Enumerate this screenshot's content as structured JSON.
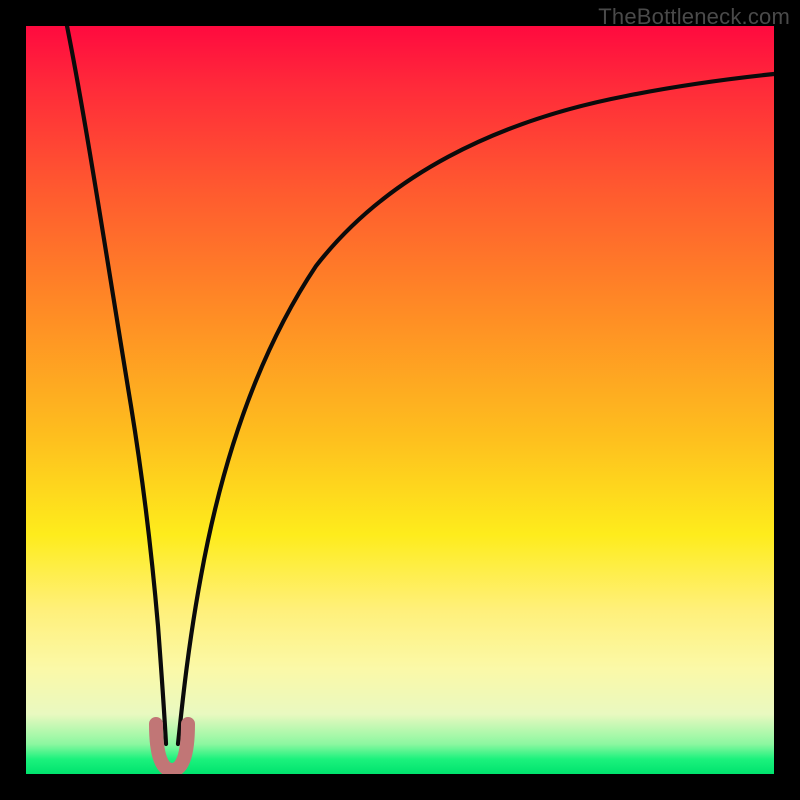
{
  "watermark": "TheBottleneck.com",
  "colors": {
    "frame": "#000000",
    "gradient_top": "#ff0a3f",
    "gradient_bottom": "#00e36e",
    "curve_stroke": "#0b0b0b",
    "dip_fill": "#c17676"
  },
  "chart_data": {
    "type": "line",
    "title": "",
    "xlabel": "",
    "ylabel": "",
    "xlim": [
      0,
      100
    ],
    "ylim": [
      0,
      100
    ],
    "note": "V-shaped curve with minimum near x≈18; left branch reaches top at x≈5.5, right branch is a sublinear rise reaching top-right near x≈100, y≈86.",
    "series": [
      {
        "name": "left-branch",
        "x": [
          5.5,
          7,
          9,
          11,
          13,
          14.5,
          16,
          17,
          17.8
        ],
        "y": [
          100,
          86,
          68,
          50,
          34,
          22,
          12,
          6,
          2
        ]
      },
      {
        "name": "right-branch",
        "x": [
          19.0,
          20,
          22,
          25,
          29,
          34,
          40,
          48,
          58,
          70,
          84,
          100
        ],
        "y": [
          2,
          6,
          14,
          24,
          36,
          47,
          56,
          64,
          71,
          77,
          82,
          86
        ]
      }
    ],
    "dip_marker": {
      "cx": 18.4,
      "cy": 2.0,
      "shape": "U",
      "color": "#c17676"
    }
  }
}
